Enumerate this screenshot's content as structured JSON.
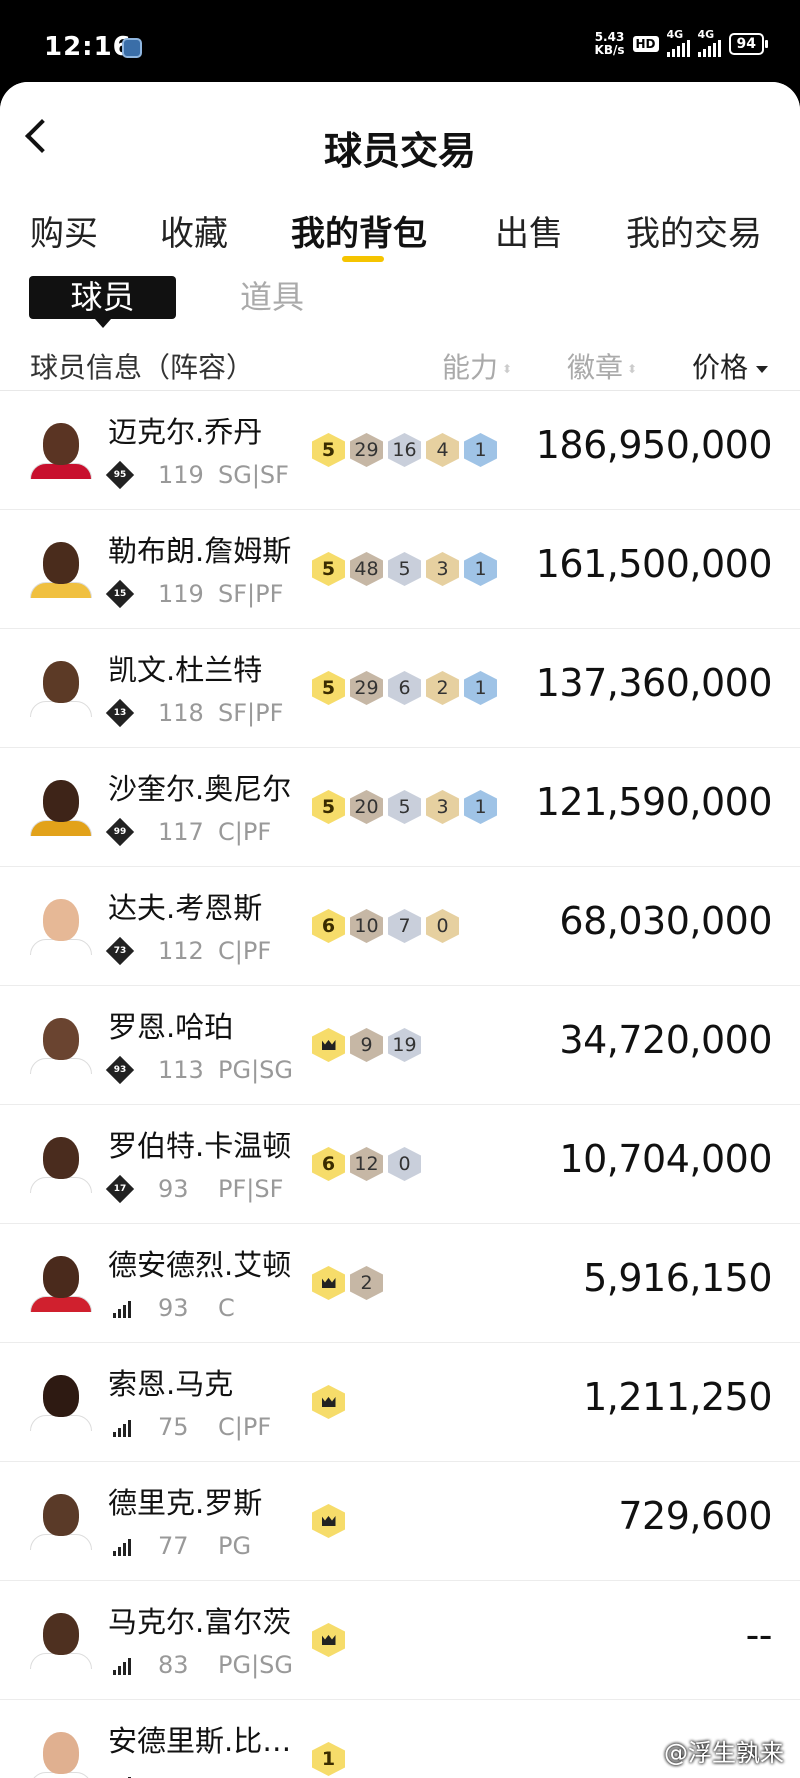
{
  "status_bar": {
    "time": "12:16",
    "net_speed_top": "5.43",
    "net_speed_bottom": "KB/s",
    "hd_label": "HD",
    "signal1_label": "4G",
    "signal2_label": "4G",
    "battery": "94"
  },
  "header": {
    "title": "球员交易"
  },
  "tabs": [
    {
      "label": "购买"
    },
    {
      "label": "收藏"
    },
    {
      "label": "我的背包",
      "active": true
    },
    {
      "label": "出售"
    },
    {
      "label": "我的交易"
    }
  ],
  "subtabs": [
    {
      "label": "球员",
      "active": true
    },
    {
      "label": "道具"
    }
  ],
  "columns": {
    "info": "球员信息（阵容）",
    "ability": "能力",
    "badge": "徽章",
    "price": "价格"
  },
  "players": [
    {
      "name": "迈克尔.乔丹",
      "lineup": "95",
      "ability": "119",
      "position": "SG|SF",
      "tier": "5",
      "badges": [
        "29",
        "16",
        "4",
        "1"
      ],
      "price": "186,950,000",
      "skin": "#5a3423",
      "jersey": "#c8102e"
    },
    {
      "name": "勒布朗.詹姆斯",
      "lineup": "15",
      "ability": "119",
      "position": "SF|PF",
      "tier": "5",
      "badges": [
        "48",
        "5",
        "3",
        "1"
      ],
      "price": "161,500,000",
      "skin": "#4a2c1c",
      "jersey": "#f0c040"
    },
    {
      "name": "凯文.杜兰特",
      "lineup": "13",
      "ability": "118",
      "position": "SF|PF",
      "tier": "5",
      "badges": [
        "29",
        "6",
        "2",
        "1"
      ],
      "price": "137,360,000",
      "skin": "#5c3a26",
      "jersey": "#ffffff"
    },
    {
      "name": "沙奎尔.奥尼尔",
      "lineup": "99",
      "ability": "117",
      "position": "C|PF",
      "tier": "5",
      "badges": [
        "20",
        "5",
        "3",
        "1"
      ],
      "price": "121,590,000",
      "skin": "#3e2418",
      "jersey": "#e2a21a"
    },
    {
      "name": "达夫.考恩斯",
      "lineup": "73",
      "ability": "112",
      "position": "C|PF",
      "tier": "6",
      "badges": [
        "10",
        "7",
        "0"
      ],
      "price": "68,030,000",
      "skin": "#e6b896",
      "jersey": "#ffffff"
    },
    {
      "name": "罗恩.哈珀",
      "lineup": "93",
      "ability": "113",
      "position": "PG|SG",
      "tier": "crown",
      "badges": [
        "9",
        "19"
      ],
      "price": "34,720,000",
      "skin": "#6a4430",
      "jersey": "#ffffff"
    },
    {
      "name": "罗伯特.卡温顿",
      "lineup": "17",
      "ability": "93",
      "position": "PF|SF",
      "tier": "6",
      "badges": [
        "12",
        "0"
      ],
      "price": "10,704,000",
      "skin": "#4a2c1e",
      "jersey": "#ffffff"
    },
    {
      "name": "德安德烈.艾顿",
      "lineup": "",
      "ability": "93",
      "position": "C",
      "tier": "crown",
      "badges": [
        "2"
      ],
      "price": "5,916,150",
      "skin": "#4a2a1c",
      "jersey": "#d0202e"
    },
    {
      "name": "索恩.马克",
      "lineup": "",
      "ability": "75",
      "position": "C|PF",
      "tier": "crown",
      "badges": [],
      "price": "1,211,250",
      "skin": "#2e1a12",
      "jersey": "#ffffff"
    },
    {
      "name": "德里克.罗斯",
      "lineup": "",
      "ability": "77",
      "position": "PG",
      "tier": "crown",
      "badges": [],
      "price": "729,600",
      "skin": "#5a3a28",
      "jersey": "#ffffff"
    },
    {
      "name": "马克尔.富尔茨",
      "lineup": "",
      "ability": "83",
      "position": "PG|SG",
      "tier": "crown",
      "badges": [],
      "price": "--",
      "skin": "#4e3020",
      "jersey": "#ffffff"
    },
    {
      "name": "安德里斯.比…",
      "lineup": "",
      "ability": "",
      "position": "",
      "tier": "1",
      "badges": [],
      "price": "",
      "skin": "#e0b090",
      "jersey": "#ffffff"
    }
  ],
  "watermark": "@浮生孰来"
}
